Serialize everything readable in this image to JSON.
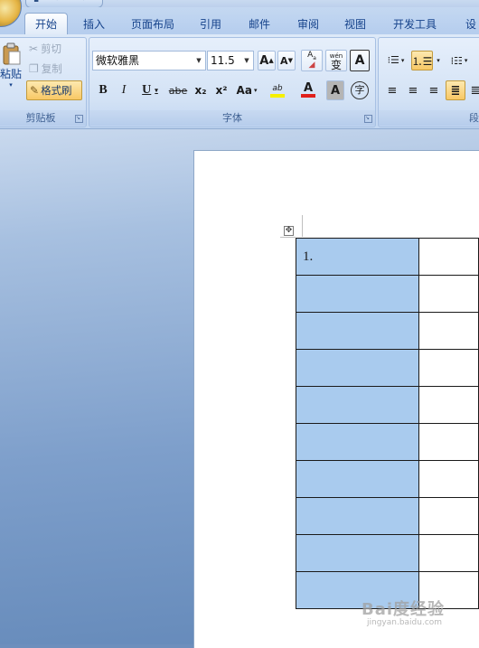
{
  "quick_access": {
    "icons": [
      "save-icon",
      "undo-icon",
      "redo-icon"
    ]
  },
  "tabs": [
    {
      "label": "开始",
      "active": true
    },
    {
      "label": "插入"
    },
    {
      "label": "页面布局"
    },
    {
      "label": "引用"
    },
    {
      "label": "邮件"
    },
    {
      "label": "审阅"
    },
    {
      "label": "视图"
    },
    {
      "label": "开发工具"
    },
    {
      "label": "设"
    }
  ],
  "clipboard": {
    "paste_label": "粘贴",
    "cut_label": "剪切",
    "copy_label": "复制",
    "format_painter_label": "格式刷",
    "group_label": "剪贴板"
  },
  "font": {
    "font_name": "微软雅黑",
    "font_size": "11.5",
    "grow_label": "A",
    "shrink_label": "A",
    "phonetic_label": "wén",
    "phonetic_char": "变",
    "border_label": "A",
    "bold_label": "B",
    "italic_label": "I",
    "underline_label": "U",
    "strike_label": "abe",
    "subscript_label": "x₂",
    "superscript_label": "x²",
    "case_label": "Aa",
    "highlight_label": "ab",
    "color_label": "A",
    "shading_label": "A",
    "enclose_label": "字",
    "group_label": "字体"
  },
  "paragraph": {
    "group_label": "段"
  },
  "colors": {
    "highlight": "#f5f000",
    "font_color": "#e0201b",
    "cell_highlight": "#a9cbee"
  },
  "document": {
    "table_rows": [
      {
        "c1": "1.",
        "c2": ""
      },
      {
        "c1": "",
        "c2": ""
      },
      {
        "c1": "",
        "c2": ""
      },
      {
        "c1": "",
        "c2": ""
      },
      {
        "c1": "",
        "c2": ""
      },
      {
        "c1": "",
        "c2": ""
      },
      {
        "c1": "",
        "c2": ""
      },
      {
        "c1": "",
        "c2": ""
      },
      {
        "c1": "",
        "c2": ""
      },
      {
        "c1": "",
        "c2": ""
      }
    ]
  },
  "watermark": {
    "main": "Bai度经验",
    "sub": "jingyan.baidu.com"
  }
}
